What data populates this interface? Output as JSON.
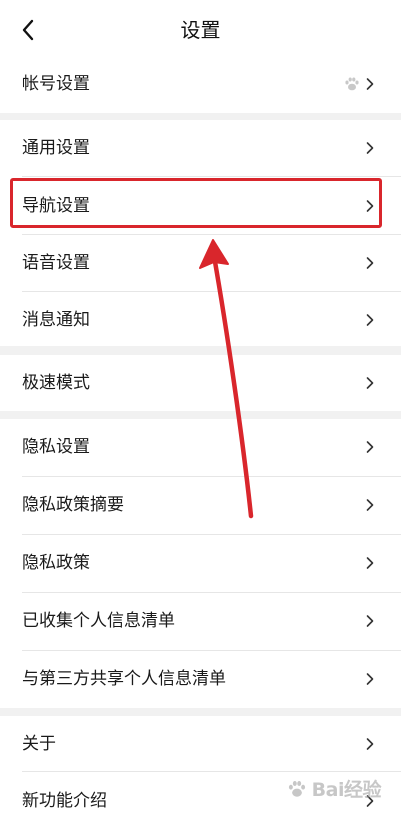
{
  "header": {
    "title": "设置",
    "back_icon": "chevron-left-icon"
  },
  "groups": [
    {
      "items": [
        {
          "label": "帐号设置",
          "badge_icon": "paw-icon"
        }
      ]
    },
    {
      "items": [
        {
          "label": "通用设置"
        },
        {
          "label": "导航设置",
          "highlighted": true
        },
        {
          "label": "语音设置"
        },
        {
          "label": "消息通知"
        }
      ]
    },
    {
      "items": [
        {
          "label": "极速模式"
        }
      ]
    },
    {
      "items": [
        {
          "label": "隐私设置"
        },
        {
          "label": "隐私政策摘要"
        },
        {
          "label": "隐私政策"
        },
        {
          "label": "已收集个人信息清单"
        },
        {
          "label": "与第三方共享个人信息清单"
        }
      ]
    },
    {
      "items": [
        {
          "label": "关于"
        },
        {
          "label": "新功能介绍"
        }
      ]
    }
  ],
  "annotation": {
    "highlight_color": "#d9262c",
    "arrow_color": "#d9262c"
  },
  "watermark": {
    "text": "Bai经验"
  }
}
